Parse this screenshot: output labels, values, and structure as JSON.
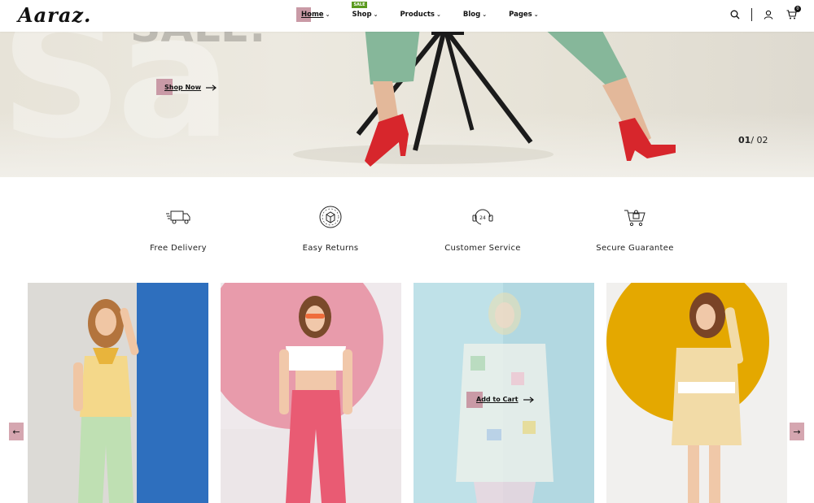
{
  "brand": {
    "logo_text": "Aaraz."
  },
  "nav": {
    "items": [
      {
        "label": "Home",
        "chevron": "⌄"
      },
      {
        "label": "Shop",
        "chevron": "⌄",
        "badge": "SALE"
      },
      {
        "label": "Products",
        "chevron": "⌄"
      },
      {
        "label": "Blog",
        "chevron": "⌄"
      },
      {
        "label": "Pages",
        "chevron": "⌄"
      }
    ]
  },
  "header_icons": [
    "search-icon",
    "user-icon",
    "cart-icon"
  ],
  "cart": {
    "count": "0"
  },
  "hero": {
    "headline": "SALE.",
    "background_word": "Sa",
    "cta_label": "Shop Now",
    "counter_current": "01",
    "counter_sep": "/",
    "counter_total": "02"
  },
  "features": [
    {
      "label": "Free Delivery",
      "icon": "delivery-truck-icon"
    },
    {
      "label": "Easy Returns",
      "icon": "returns-box-icon"
    },
    {
      "label": "Customer Service",
      "icon": "support-24-icon"
    },
    {
      "label": "Secure Guarantee",
      "icon": "secure-cart-icon"
    }
  ],
  "products": {
    "add_to_cart_label": "Add to Cart",
    "prev_arrow": "←",
    "next_arrow": "→"
  },
  "colors": {
    "accent_pink": "#c99aa6",
    "sale_badge": "#5b9a1f",
    "card2_bg": "#e8576f",
    "card1_blue": "#2e6fbe",
    "card3_bg": "#b9dde6",
    "card4_yellow": "#e4a800"
  }
}
